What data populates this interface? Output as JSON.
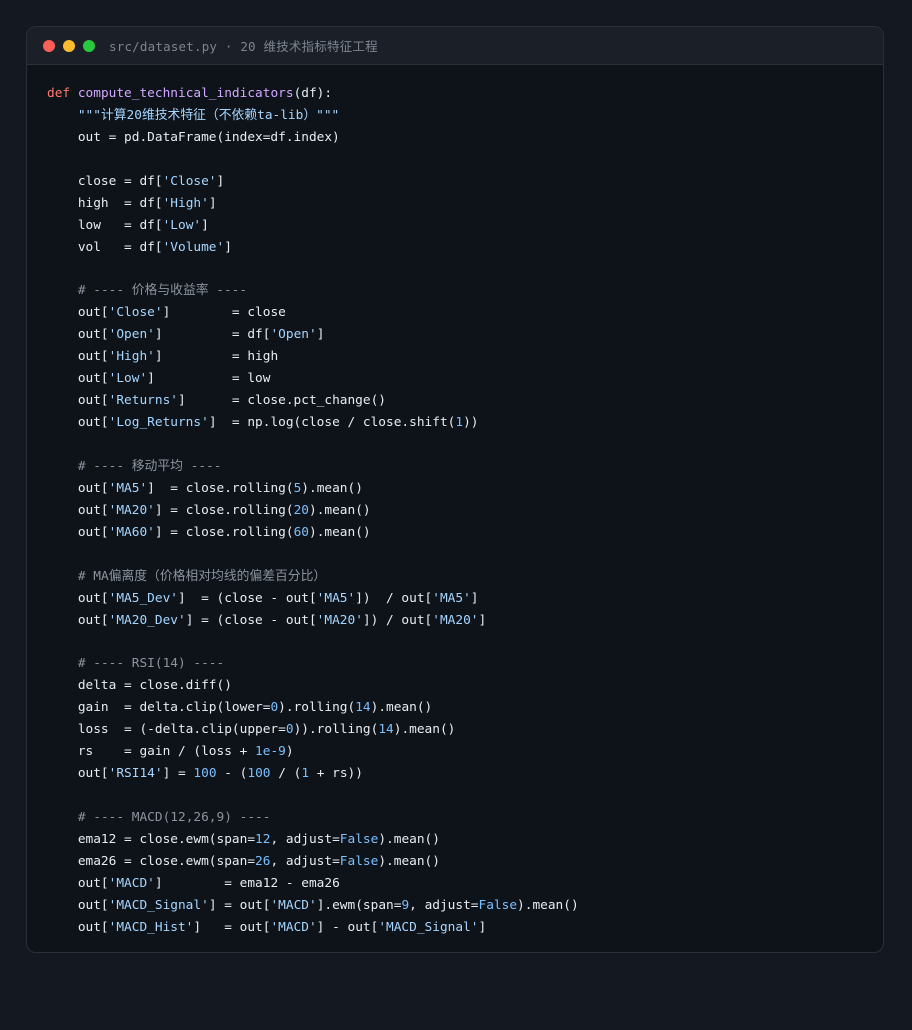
{
  "window": {
    "title": "src/dataset.py · 20 维技术指标特征工程"
  },
  "colors": {
    "background": "#141821",
    "editor": "#0e1219",
    "titlebar": "#1b2028",
    "keyword": "#ff7b72",
    "function": "#d2a8ff",
    "string": "#a5d6ff",
    "number": "#79c0ff",
    "comment": "#8b949e",
    "text": "#e6edf3",
    "traffic_red": "#ff5f57",
    "traffic_yellow": "#febc2e",
    "traffic_green": "#28c840"
  },
  "code": {
    "language": "python",
    "lines": [
      [
        [
          "kw",
          "def "
        ],
        [
          "fn",
          "compute_technical_indicators"
        ],
        [
          "t",
          "(df):"
        ]
      ],
      [
        [
          "t",
          "    "
        ],
        [
          "str",
          "\"\"\"计算20维技术特征（不依赖ta-lib）\"\"\""
        ]
      ],
      [
        [
          "t",
          "    out = pd.DataFrame(index=df.index)"
        ]
      ],
      [],
      [
        [
          "t",
          "    close = df["
        ],
        [
          "str",
          "'Close'"
        ],
        [
          "t",
          "]"
        ]
      ],
      [
        [
          "t",
          "    high  = df["
        ],
        [
          "str",
          "'High'"
        ],
        [
          "t",
          "]"
        ]
      ],
      [
        [
          "t",
          "    low   = df["
        ],
        [
          "str",
          "'Low'"
        ],
        [
          "t",
          "]"
        ]
      ],
      [
        [
          "t",
          "    vol   = df["
        ],
        [
          "str",
          "'Volume'"
        ],
        [
          "t",
          "]"
        ]
      ],
      [],
      [
        [
          "t",
          "    "
        ],
        [
          "cm",
          "# ---- 价格与收益率 ----"
        ]
      ],
      [
        [
          "t",
          "    out["
        ],
        [
          "str",
          "'Close'"
        ],
        [
          "t",
          "]        = close"
        ]
      ],
      [
        [
          "t",
          "    out["
        ],
        [
          "str",
          "'Open'"
        ],
        [
          "t",
          "]         = df["
        ],
        [
          "str",
          "'Open'"
        ],
        [
          "t",
          "]"
        ]
      ],
      [
        [
          "t",
          "    out["
        ],
        [
          "str",
          "'High'"
        ],
        [
          "t",
          "]         = high"
        ]
      ],
      [
        [
          "t",
          "    out["
        ],
        [
          "str",
          "'Low'"
        ],
        [
          "t",
          "]          = low"
        ]
      ],
      [
        [
          "t",
          "    out["
        ],
        [
          "str",
          "'Returns'"
        ],
        [
          "t",
          "]      = close.pct_change()"
        ]
      ],
      [
        [
          "t",
          "    out["
        ],
        [
          "str",
          "'Log_Returns'"
        ],
        [
          "t",
          "]  = np.log(close / close.shift("
        ],
        [
          "num",
          "1"
        ],
        [
          "t",
          "))"
        ]
      ],
      [],
      [
        [
          "t",
          "    "
        ],
        [
          "cm",
          "# ---- 移动平均 ----"
        ]
      ],
      [
        [
          "t",
          "    out["
        ],
        [
          "str",
          "'MA5'"
        ],
        [
          "t",
          "]  = close.rolling("
        ],
        [
          "num",
          "5"
        ],
        [
          "t",
          ").mean()"
        ]
      ],
      [
        [
          "t",
          "    out["
        ],
        [
          "str",
          "'MA20'"
        ],
        [
          "t",
          "] = close.rolling("
        ],
        [
          "num",
          "20"
        ],
        [
          "t",
          ").mean()"
        ]
      ],
      [
        [
          "t",
          "    out["
        ],
        [
          "str",
          "'MA60'"
        ],
        [
          "t",
          "] = close.rolling("
        ],
        [
          "num",
          "60"
        ],
        [
          "t",
          ").mean()"
        ]
      ],
      [],
      [
        [
          "t",
          "    "
        ],
        [
          "cm",
          "# MA偏离度（价格相对均线的偏差百分比）"
        ]
      ],
      [
        [
          "t",
          "    out["
        ],
        [
          "str",
          "'MA5_Dev'"
        ],
        [
          "t",
          "]  = (close - out["
        ],
        [
          "str",
          "'MA5'"
        ],
        [
          "t",
          "])  / out["
        ],
        [
          "str",
          "'MA5'"
        ],
        [
          "t",
          "]"
        ]
      ],
      [
        [
          "t",
          "    out["
        ],
        [
          "str",
          "'MA20_Dev'"
        ],
        [
          "t",
          "] = (close - out["
        ],
        [
          "str",
          "'MA20'"
        ],
        [
          "t",
          "]) / out["
        ],
        [
          "str",
          "'MA20'"
        ],
        [
          "t",
          "]"
        ]
      ],
      [],
      [
        [
          "t",
          "    "
        ],
        [
          "cm",
          "# ---- RSI(14) ----"
        ]
      ],
      [
        [
          "t",
          "    delta = close.diff()"
        ]
      ],
      [
        [
          "t",
          "    gain  = delta.clip(lower="
        ],
        [
          "num",
          "0"
        ],
        [
          "t",
          ").rolling("
        ],
        [
          "num",
          "14"
        ],
        [
          "t",
          ").mean()"
        ]
      ],
      [
        [
          "t",
          "    loss  = (-delta.clip(upper="
        ],
        [
          "num",
          "0"
        ],
        [
          "t",
          ")).rolling("
        ],
        [
          "num",
          "14"
        ],
        [
          "t",
          ").mean()"
        ]
      ],
      [
        [
          "t",
          "    rs    = gain / (loss + "
        ],
        [
          "num",
          "1e-9"
        ],
        [
          "t",
          ")"
        ]
      ],
      [
        [
          "t",
          "    out["
        ],
        [
          "str",
          "'RSI14'"
        ],
        [
          "t",
          "] = "
        ],
        [
          "num",
          "100"
        ],
        [
          "t",
          " - ("
        ],
        [
          "num",
          "100"
        ],
        [
          "t",
          " / ("
        ],
        [
          "num",
          "1"
        ],
        [
          "t",
          " + rs))"
        ]
      ],
      [],
      [
        [
          "t",
          "    "
        ],
        [
          "cm",
          "# ---- MACD(12,26,9) ----"
        ]
      ],
      [
        [
          "t",
          "    ema12 = close.ewm(span="
        ],
        [
          "num",
          "12"
        ],
        [
          "t",
          ", adjust="
        ],
        [
          "const",
          "False"
        ],
        [
          "t",
          ").mean()"
        ]
      ],
      [
        [
          "t",
          "    ema26 = close.ewm(span="
        ],
        [
          "num",
          "26"
        ],
        [
          "t",
          ", adjust="
        ],
        [
          "const",
          "False"
        ],
        [
          "t",
          ").mean()"
        ]
      ],
      [
        [
          "t",
          "    out["
        ],
        [
          "str",
          "'MACD'"
        ],
        [
          "t",
          "]        = ema12 - ema26"
        ]
      ],
      [
        [
          "t",
          "    out["
        ],
        [
          "str",
          "'MACD_Signal'"
        ],
        [
          "t",
          "] = out["
        ],
        [
          "str",
          "'MACD'"
        ],
        [
          "t",
          "].ewm(span="
        ],
        [
          "num",
          "9"
        ],
        [
          "t",
          ", adjust="
        ],
        [
          "const",
          "False"
        ],
        [
          "t",
          ").mean()"
        ]
      ],
      [
        [
          "t",
          "    out["
        ],
        [
          "str",
          "'MACD_Hist'"
        ],
        [
          "t",
          "]   = out["
        ],
        [
          "str",
          "'MACD'"
        ],
        [
          "t",
          "] - out["
        ],
        [
          "str",
          "'MACD_Signal'"
        ],
        [
          "t",
          "]"
        ]
      ]
    ]
  }
}
